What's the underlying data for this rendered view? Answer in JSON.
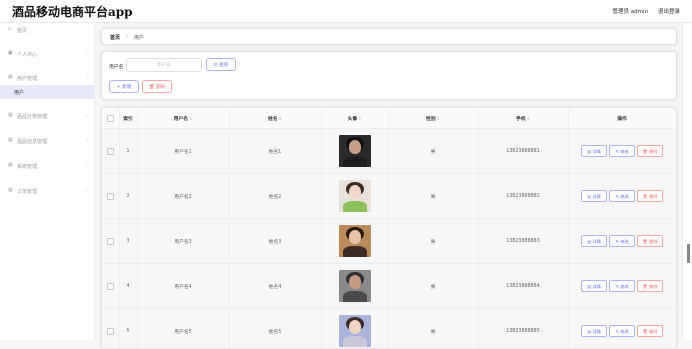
{
  "header": {
    "app_title": "酒品移动电商平台app",
    "role": "管理员 admin",
    "logout": "退出登录"
  },
  "sidebar": {
    "items": [
      {
        "label": "首页",
        "icon": "home-icon",
        "has_children": false,
        "active": false
      },
      {
        "label": "个人中心",
        "icon": "person-icon",
        "has_children": true,
        "active": false
      },
      {
        "label": "用户管理",
        "icon": "grid-icon",
        "has_children": true,
        "active": false
      },
      {
        "label": "用户",
        "icon": "",
        "has_children": false,
        "active": true
      },
      {
        "label": "酒品分类管理",
        "icon": "grid-icon",
        "has_children": true,
        "active": false
      },
      {
        "label": "酒品信息管理",
        "icon": "grid-icon",
        "has_children": true,
        "active": false
      },
      {
        "label": "系统管理",
        "icon": "grid-icon",
        "has_children": true,
        "active": false
      },
      {
        "label": "订单管理",
        "icon": "grid-icon",
        "has_children": true,
        "active": false
      }
    ]
  },
  "breadcrumb": {
    "home": "首页",
    "sep": "/",
    "current": "用户"
  },
  "search": {
    "label": "用户名",
    "placeholder": "用户名",
    "query_button": "查询",
    "add_button": "新增",
    "delete_button": "删除"
  },
  "table": {
    "headers": {
      "index": "索引",
      "username": "用户名",
      "name": "姓名",
      "avatar": "头像",
      "gender": "性别",
      "phone": "手机",
      "ops": "操作"
    },
    "ops": {
      "detail": "详情",
      "edit": "修改",
      "delete": "删除"
    },
    "rows": [
      {
        "index": "1",
        "username": "用户名1",
        "name": "姓名1",
        "gender": "男",
        "phone": "13823888881"
      },
      {
        "index": "2",
        "username": "用户名2",
        "name": "姓名2",
        "gender": "男",
        "phone": "13823888882"
      },
      {
        "index": "3",
        "username": "用户名3",
        "name": "姓名3",
        "gender": "男",
        "phone": "13823888883"
      },
      {
        "index": "4",
        "username": "用户名4",
        "name": "姓名4",
        "gender": "男",
        "phone": "13823888884"
      },
      {
        "index": "5",
        "username": "用户名5",
        "name": "姓名5",
        "gender": "男",
        "phone": "13823888885"
      }
    ]
  },
  "colors": {
    "accent": "#6272e6",
    "danger": "#f56c6c",
    "active_menu_bg": "#e6e9fb"
  }
}
